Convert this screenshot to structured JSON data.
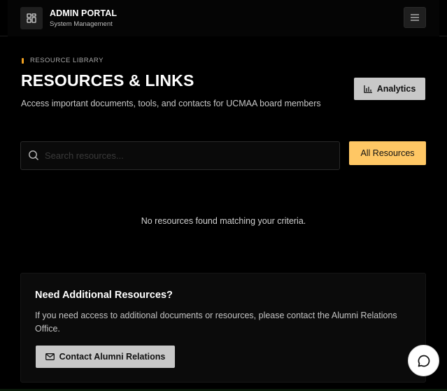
{
  "header": {
    "brand_title": "ADMIN PORTAL",
    "brand_subtitle": "System Management",
    "logo_icon": "grid-icon",
    "menu_icon": "hamburger-icon"
  },
  "main": {
    "eyebrow": "RESOURCE LIBRARY",
    "title": "RESOURCES & LINKS",
    "description": "Access important documents, tools, and contacts for UCMAA board members",
    "analytics_label": "Analytics",
    "search": {
      "placeholder": "Search resources...",
      "value": ""
    },
    "filter_label": "All Resources",
    "empty_message": "No resources found matching your criteria."
  },
  "help_card": {
    "title": "Need Additional Resources?",
    "text": "If you need access to additional documents or resources, please contact the Alumni Relations Office.",
    "button_label": "Contact Alumni Relations"
  },
  "colors": {
    "accent": "#ffc764",
    "eyebrow_mark": "#f0a020",
    "background": "#000000"
  }
}
